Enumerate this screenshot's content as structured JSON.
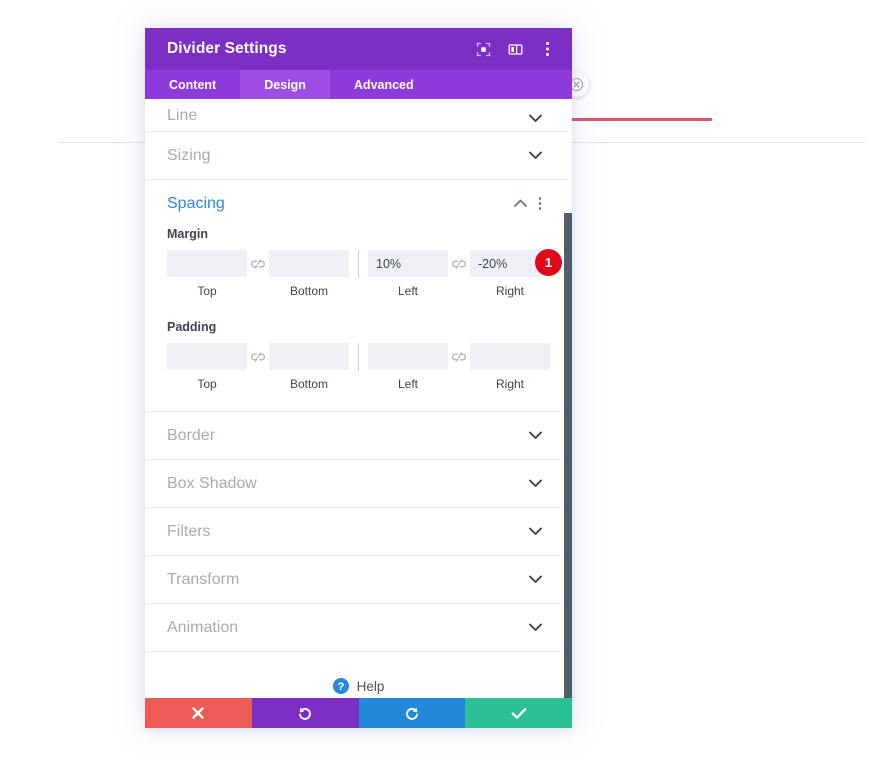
{
  "background": {
    "red_divider_name": "red-divider-line",
    "gray_divider_name": "horizontal-rule",
    "close_circle_name": "close-overlay-button"
  },
  "modal": {
    "title": "Divider Settings",
    "header_icons": [
      {
        "name": "focus-target-icon",
        "label": "Focus"
      },
      {
        "name": "layout-columns-icon",
        "label": "Layout"
      },
      {
        "name": "more-options-icon",
        "label": "More"
      }
    ],
    "tabs": [
      {
        "label": "Content",
        "active": false
      },
      {
        "label": "Design",
        "active": true
      },
      {
        "label": "Advanced",
        "active": false
      }
    ],
    "sections": [
      {
        "label": "Line",
        "open": false
      },
      {
        "label": "Sizing",
        "open": false
      },
      {
        "label": "Spacing",
        "open": true
      },
      {
        "label": "Border",
        "open": false
      },
      {
        "label": "Box Shadow",
        "open": false
      },
      {
        "label": "Filters",
        "open": false
      },
      {
        "label": "Transform",
        "open": false
      },
      {
        "label": "Animation",
        "open": false
      }
    ],
    "spacing": {
      "margin": {
        "group_label": "Margin",
        "fields": [
          {
            "caption": "Top",
            "value": "",
            "placeholder": ""
          },
          {
            "caption": "Bottom",
            "value": "",
            "placeholder": ""
          },
          {
            "caption": "Left",
            "value": "10%",
            "placeholder": ""
          },
          {
            "caption": "Right",
            "value": "-20%",
            "placeholder": ""
          }
        ],
        "badge": "1"
      },
      "padding": {
        "group_label": "Padding",
        "fields": [
          {
            "caption": "Top",
            "value": "",
            "placeholder": ""
          },
          {
            "caption": "Bottom",
            "value": "",
            "placeholder": ""
          },
          {
            "caption": "Left",
            "value": "",
            "placeholder": ""
          },
          {
            "caption": "Right",
            "value": "",
            "placeholder": ""
          }
        ]
      },
      "link_icon_name": "broken-link-icon"
    },
    "help": {
      "label": "Help",
      "icon": "help-circle-icon"
    },
    "footer_buttons": [
      {
        "name": "discard-button",
        "icon": "close-icon",
        "color": "#ec5b56"
      },
      {
        "name": "undo-button",
        "icon": "undo-icon",
        "color": "#7b2fc4"
      },
      {
        "name": "redo-button",
        "icon": "redo-icon",
        "color": "#2288d8"
      },
      {
        "name": "save-button",
        "icon": "check-icon",
        "color": "#2bbf95"
      }
    ]
  },
  "colors": {
    "header_purple": "#7b2fc4",
    "tabs_purple": "#8e39da",
    "tab_active_purple": "#9d4de3",
    "accent_blue": "#2b87da",
    "badge_red": "#e2061b",
    "divider_red": "#d9566b",
    "scrollbar": "#4e5c6b"
  }
}
